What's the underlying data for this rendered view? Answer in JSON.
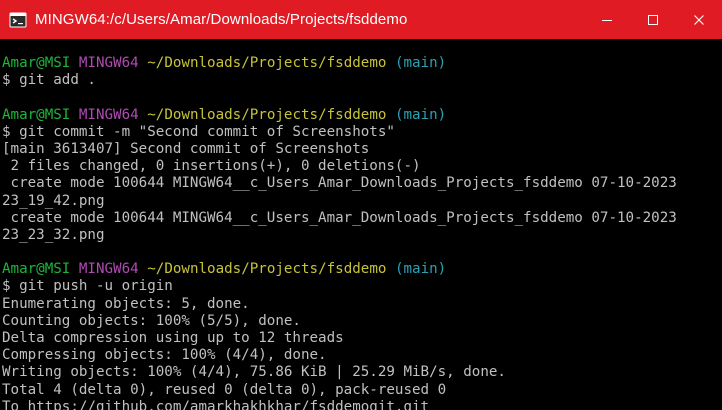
{
  "window": {
    "title": "MINGW64:/c/Users/Amar/Downloads/Projects/fsddemo",
    "app_icon": "git-bash-icon",
    "controls": [
      "minimize-icon",
      "maximize-icon",
      "close-icon"
    ],
    "titlebar_color": "#e01b24"
  },
  "colors": {
    "background": "#000000",
    "text": "#c0c0c0",
    "user_host": "#1db53a",
    "msystem": "#b04bb2",
    "path": "#c7c33a",
    "branch": "#2aa1b3"
  },
  "terminal": {
    "lines": [
      {
        "type": "prompt",
        "user": "Amar@MSI",
        "msystem": "MINGW64",
        "path": "~/Downloads/Projects/fsddemo",
        "branch": "(main)"
      },
      {
        "type": "text",
        "text": "$ git add ."
      },
      {
        "type": "text",
        "text": ""
      },
      {
        "type": "prompt",
        "user": "Amar@MSI",
        "msystem": "MINGW64",
        "path": "~/Downloads/Projects/fsddemo",
        "branch": "(main)"
      },
      {
        "type": "text",
        "text": "$ git commit -m \"Second commit of Screenshots\""
      },
      {
        "type": "text",
        "text": "[main 3613407] Second commit of Screenshots"
      },
      {
        "type": "text",
        "text": " 2 files changed, 0 insertions(+), 0 deletions(-)"
      },
      {
        "type": "text",
        "text": " create mode 100644 MINGW64__c_Users_Amar_Downloads_Projects_fsddemo 07-10-2023"
      },
      {
        "type": "text",
        "text": "23_19_42.png"
      },
      {
        "type": "text",
        "text": " create mode 100644 MINGW64__c_Users_Amar_Downloads_Projects_fsddemo 07-10-2023"
      },
      {
        "type": "text",
        "text": "23_23_32.png"
      },
      {
        "type": "text",
        "text": ""
      },
      {
        "type": "prompt",
        "user": "Amar@MSI",
        "msystem": "MINGW64",
        "path": "~/Downloads/Projects/fsddemo",
        "branch": "(main)"
      },
      {
        "type": "text",
        "text": "$ git push -u origin"
      },
      {
        "type": "text",
        "text": "Enumerating objects: 5, done."
      },
      {
        "type": "text",
        "text": "Counting objects: 100% (5/5), done."
      },
      {
        "type": "text",
        "text": "Delta compression using up to 12 threads"
      },
      {
        "type": "text",
        "text": "Compressing objects: 100% (4/4), done."
      },
      {
        "type": "text",
        "text": "Writing objects: 100% (4/4), 75.86 KiB | 25.29 MiB/s, done."
      },
      {
        "type": "text",
        "text": "Total 4 (delta 0), reused 0 (delta 0), pack-reused 0"
      },
      {
        "type": "text",
        "text": "To https://github.com/amarkhakhkhar/fsddemogit.git"
      }
    ]
  }
}
